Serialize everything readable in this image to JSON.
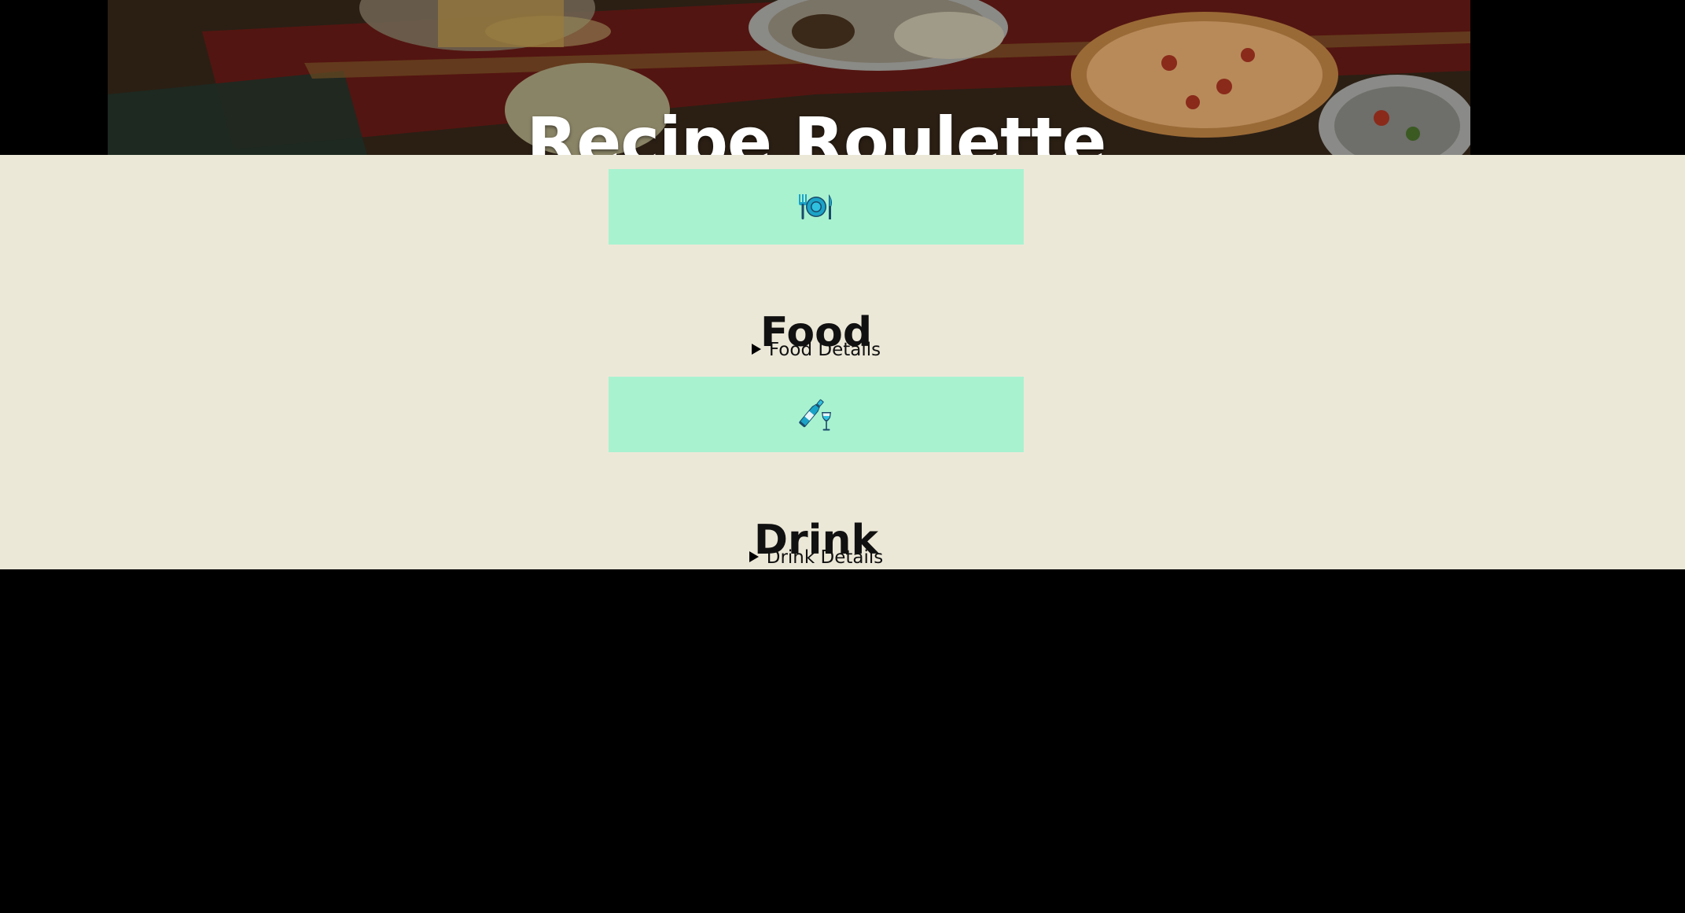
{
  "header": {
    "title": "Recipe Roulette",
    "background": "food-platter-photo"
  },
  "sections": [
    {
      "icon": "plate-cutlery-icon",
      "title": "Food",
      "details_label": "Food Details"
    },
    {
      "icon": "wine-bottle-glass-icon",
      "title": "Drink",
      "details_label": "Drink Details"
    }
  ],
  "colors": {
    "content_background": "#ece8d8",
    "card_background": "#a8f2d0",
    "icon_accent": "#1aa3c7",
    "page_background": "#000000"
  }
}
